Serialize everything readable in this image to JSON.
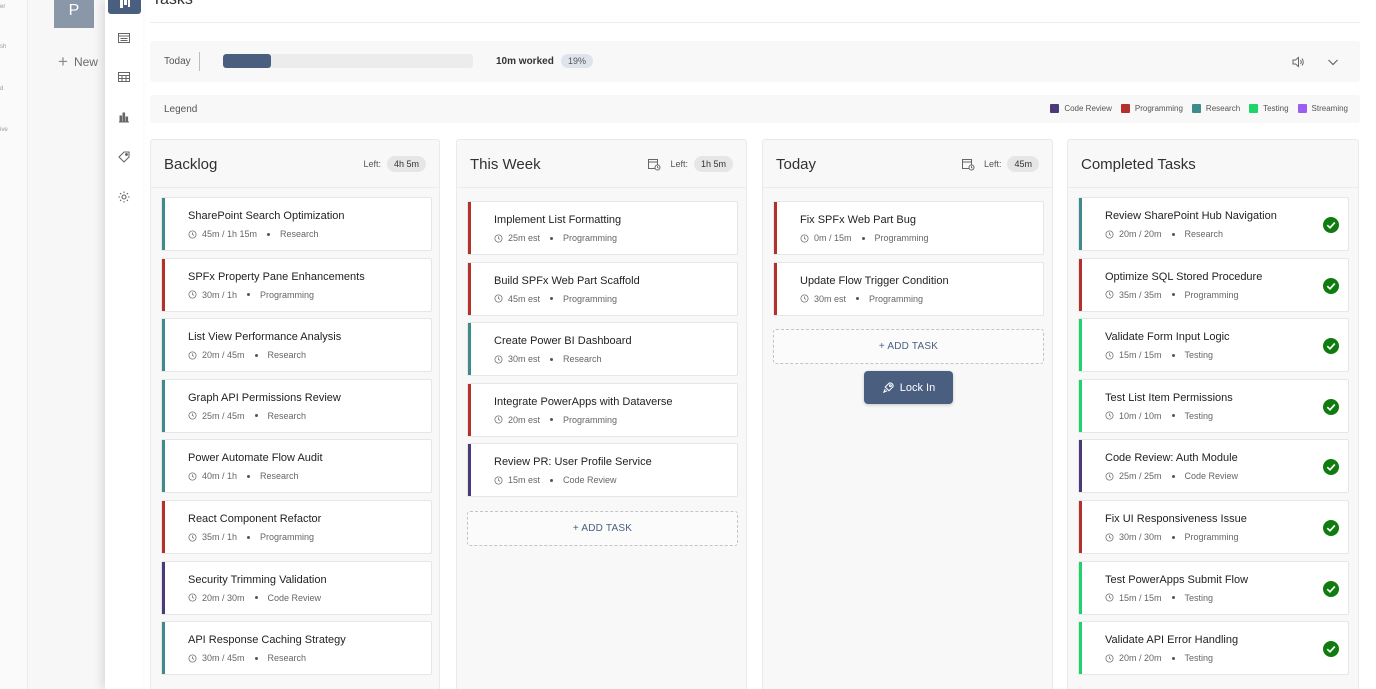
{
  "far_strip": {
    "fragments": [
      "er",
      "sh",
      "d",
      "ive"
    ]
  },
  "sidebar": {
    "avatar_letter": "P",
    "new_label": "New"
  },
  "rail": {
    "icons": [
      "board-icon",
      "list-icon",
      "calendar-icon",
      "chart-icon",
      "tag-icon",
      "gear-icon"
    ]
  },
  "page": {
    "title": "Tasks"
  },
  "today_bar": {
    "label": "Today",
    "progress": 0.19,
    "worked": "10m worked",
    "percent": "19%"
  },
  "legend": {
    "label": "Legend",
    "items": [
      {
        "name": "Code Review",
        "color": "#4b3a7a"
      },
      {
        "name": "Programming",
        "color": "#b4312b"
      },
      {
        "name": "Research",
        "color": "#3f8a8c"
      },
      {
        "name": "Testing",
        "color": "#1dd36a"
      },
      {
        "name": "Streaming",
        "color": "#9b5ef0"
      }
    ]
  },
  "columns": {
    "backlog": {
      "title": "Backlog",
      "left_label": "Left:",
      "left_value": "4h 5m",
      "cards": [
        {
          "title": "SharePoint Search Optimization",
          "time": "45m / 1h 15m",
          "category": "Research"
        },
        {
          "title": "SPFx Property Pane Enhancements",
          "time": "30m / 1h",
          "category": "Programming"
        },
        {
          "title": "List View Performance Analysis",
          "time": "20m / 45m",
          "category": "Research"
        },
        {
          "title": "Graph API Permissions Review",
          "time": "25m / 45m",
          "category": "Research"
        },
        {
          "title": "Power Automate Flow Audit",
          "time": "40m / 1h",
          "category": "Research"
        },
        {
          "title": "React Component Refactor",
          "time": "35m / 1h",
          "category": "Programming"
        },
        {
          "title": "Security Trimming Validation",
          "time": "20m / 30m",
          "category": "Code Review"
        },
        {
          "title": "API Response Caching Strategy",
          "time": "30m / 45m",
          "category": "Research"
        }
      ]
    },
    "this_week": {
      "title": "This Week",
      "left_label": "Left:",
      "left_value": "1h 5m",
      "add_label": "+ ADD TASK",
      "cards": [
        {
          "title": "Implement List Formatting",
          "time": "25m est",
          "category": "Programming"
        },
        {
          "title": "Build SPFx Web Part Scaffold",
          "time": "45m est",
          "category": "Programming"
        },
        {
          "title": "Create Power BI Dashboard",
          "time": "30m est",
          "category": "Research"
        },
        {
          "title": "Integrate PowerApps with Dataverse",
          "time": "20m est",
          "category": "Programming"
        },
        {
          "title": "Review PR: User Profile Service",
          "time": "15m est",
          "category": "Code Review"
        }
      ]
    },
    "today": {
      "title": "Today",
      "left_label": "Left:",
      "left_value": "45m",
      "add_label": "+ ADD TASK",
      "lock_label": "Lock In",
      "cards": [
        {
          "title": "Fix SPFx Web Part Bug",
          "time": "0m / 15m",
          "category": "Programming"
        },
        {
          "title": "Update Flow Trigger Condition",
          "time": "30m est",
          "category": "Programming"
        }
      ]
    },
    "completed": {
      "title": "Completed Tasks",
      "cards": [
        {
          "title": "Review SharePoint Hub Navigation",
          "time": "20m / 20m",
          "category": "Research"
        },
        {
          "title": "Optimize SQL Stored Procedure",
          "time": "35m / 35m",
          "category": "Programming"
        },
        {
          "title": "Validate Form Input Logic",
          "time": "15m / 15m",
          "category": "Testing"
        },
        {
          "title": "Test List Item Permissions",
          "time": "10m / 10m",
          "category": "Testing"
        },
        {
          "title": "Code Review: Auth Module",
          "time": "25m / 25m",
          "category": "Code Review"
        },
        {
          "title": "Fix UI Responsiveness Issue",
          "time": "30m / 30m",
          "category": "Programming"
        },
        {
          "title": "Test PowerApps Submit Flow",
          "time": "15m / 15m",
          "category": "Testing"
        },
        {
          "title": "Validate API Error Handling",
          "time": "20m / 20m",
          "category": "Testing"
        }
      ]
    }
  }
}
